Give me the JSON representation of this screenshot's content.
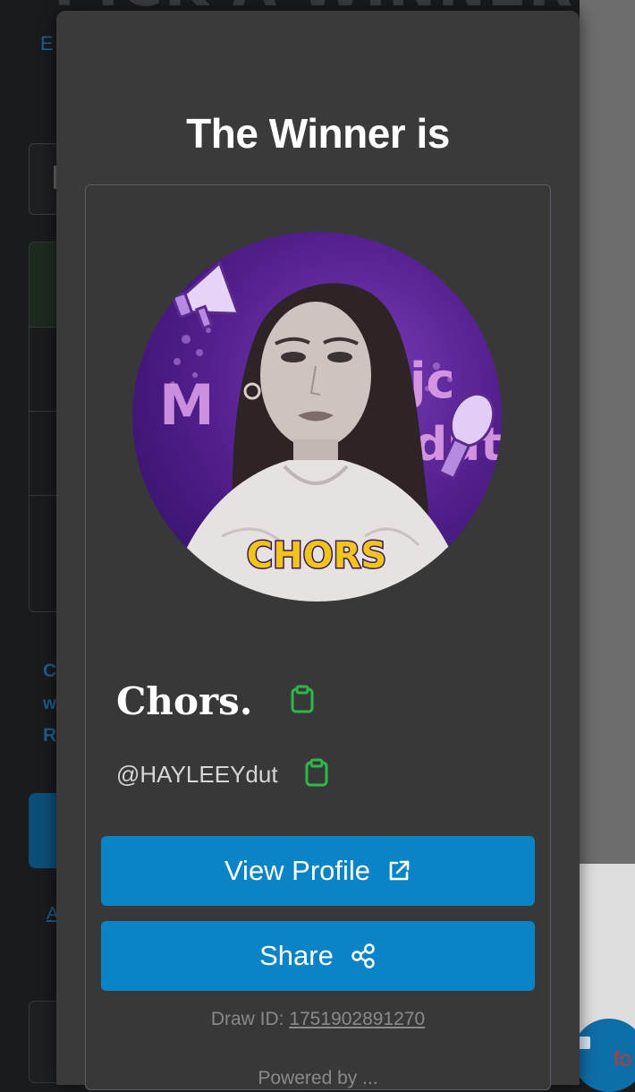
{
  "background": {
    "page_title_partial": "PICK A WINNER",
    "link_letter_e": "E",
    "text_letters": [
      "C",
      "w",
      "R"
    ],
    "link_letter_a": "A",
    "footer_text_partial": "fo"
  },
  "modal": {
    "title": "The Winner is",
    "winner": {
      "avatar_badge": "CHORS",
      "name": "Chors.",
      "handle": "@HAYLEEYdut"
    },
    "buttons": {
      "view_profile": "View Profile",
      "share": "Share"
    },
    "draw_id_label": "Draw ID: ",
    "draw_id_value": "1751902891270",
    "powered_partial": "Powered by ..."
  },
  "colors": {
    "accent_button": "#0a84c6",
    "copy_icon": "#2fb84a",
    "modal_bg": "#3a3a3a"
  }
}
